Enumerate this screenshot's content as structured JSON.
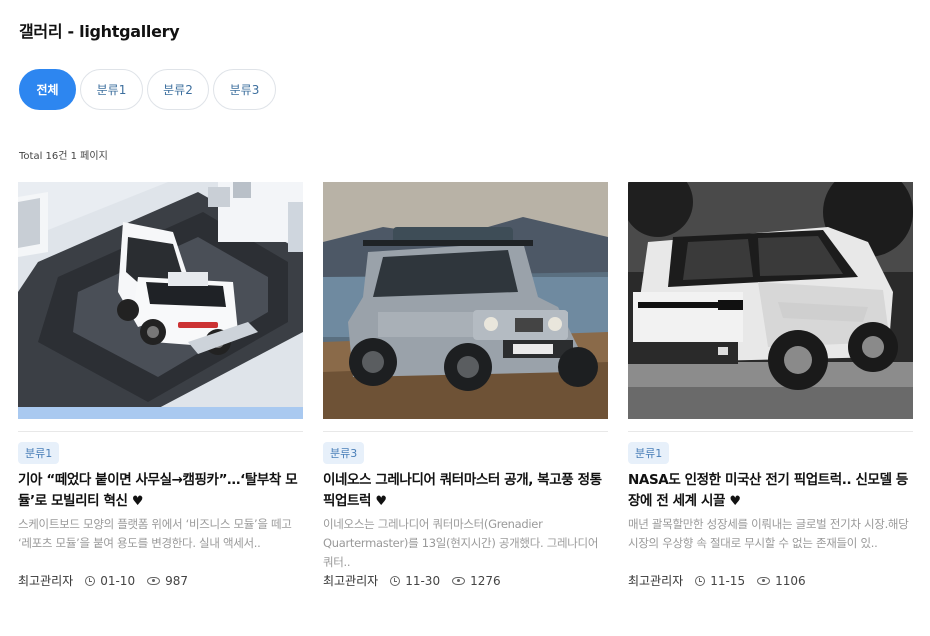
{
  "page": {
    "title": "갤러리 - lightgallery"
  },
  "tabs": [
    {
      "label": "전체",
      "active": true
    },
    {
      "label": "분류1",
      "active": false
    },
    {
      "label": "분류2",
      "active": false
    },
    {
      "label": "분류3",
      "active": false
    }
  ],
  "summary": {
    "total_text": "Total 16건 1 페이지"
  },
  "posts": [
    {
      "category": "분류1",
      "title": "기아 “떼었다 붙이면 사무실→캠핑카”…‘탈부착 모듈’로 모빌리티 혁신",
      "heart": "♥",
      "excerpt": " 스케이트보드 모양의 플랫폼 위에서 ‘비즈니스 모듈’을 떼고 ‘레포츠 모듈’을 붙여 용도를 변경한다. 실내 액세서..",
      "author": "최고관리자",
      "date": "01-10",
      "views": "987",
      "image": "white-modular-van-on-platform"
    },
    {
      "category": "분류3",
      "title": "이네오스 그레나디어 쿼터마스터 공개, 복고풍 정통 픽업트럭",
      "heart": "♥",
      "excerpt": "이네오스는 그레나디어 쿼터마스터(Grenadier Quartermaster)를 13일(현지시간) 공개했다. 그레나디어 쿼터..",
      "author": "최고관리자",
      "date": "11-30",
      "views": "1276",
      "image": "silver-pickup-truck-on-beach"
    },
    {
      "category": "분류1",
      "title": "NASA도 인정한 미국산 전기 픽업트럭.. 신모델 등장에 전 세계 시끌",
      "heart": "♥",
      "excerpt": " 매년 괄목할만한 성장세를 이뤄내는 글로벌 전기차 시장.해당 시장의 우상향 속 절대로 무시할 수 없는 존재들이 있..",
      "author": "최고관리자",
      "date": "11-15",
      "views": "1106",
      "image": "white-electric-pickup-truck"
    }
  ]
}
